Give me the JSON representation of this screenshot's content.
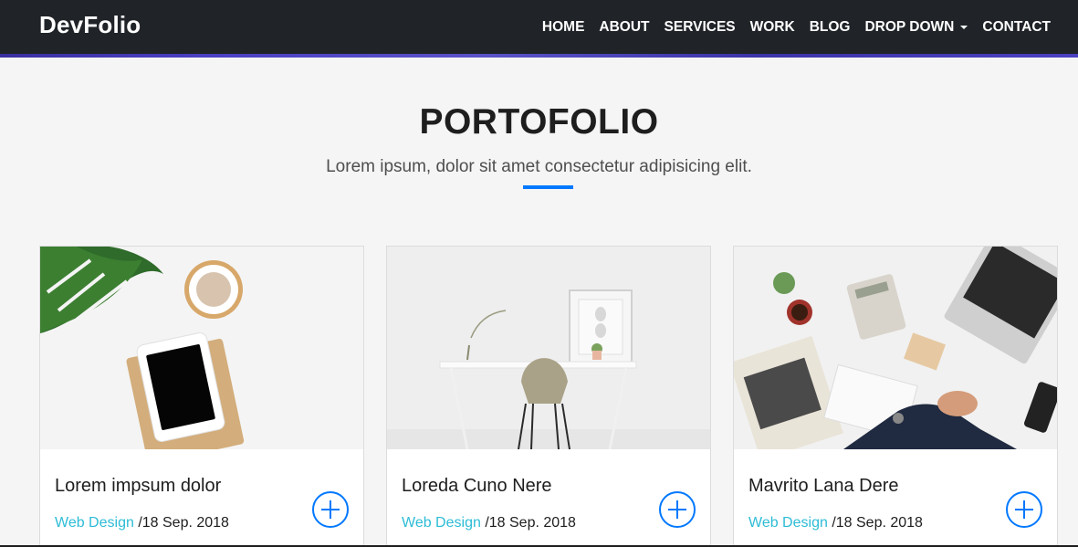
{
  "nav": {
    "brand": "DevFolio",
    "links": [
      "HOME",
      "ABOUT",
      "SERVICES",
      "WORK",
      "BLOG",
      "DROP DOWN",
      "CONTACT"
    ]
  },
  "section": {
    "title": "PORTOFOLIO",
    "subtitle": "Lorem ipsum, dolor sit amet consectetur adipisicing elit."
  },
  "cards": [
    {
      "title": "Lorem impsum dolor",
      "category": "Web Design",
      "date": "/18 Sep. 2018",
      "image": "workspace-tablet-plant-coffee"
    },
    {
      "title": "Loreda Cuno Nere",
      "category": "Web Design",
      "date": "/18 Sep. 2018",
      "image": "white-desk-chair"
    },
    {
      "title": "Mavrito Lana Dere",
      "category": "Web Design",
      "date": "/18 Sep. 2018",
      "image": "business-desk-laptop"
    }
  ],
  "colors": {
    "navbar": "#202428",
    "accent": "#0078ff",
    "category": "#2dbcd6"
  }
}
